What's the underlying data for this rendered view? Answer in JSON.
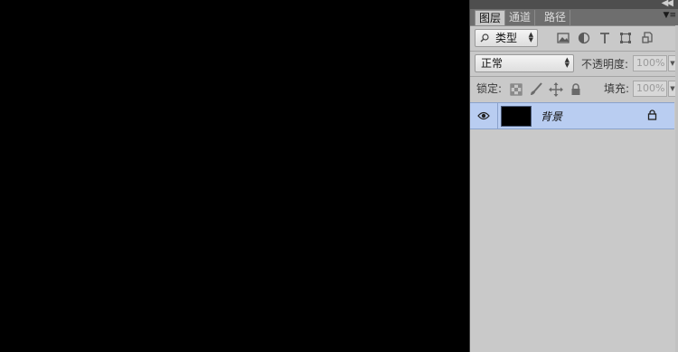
{
  "tabs": [
    {
      "label": "图层",
      "active": true
    },
    {
      "label": "通道",
      "active": false
    },
    {
      "label": "路径",
      "active": false
    }
  ],
  "filter": {
    "icon": "search-icon",
    "value": "类型"
  },
  "filter_icons": [
    "image-filter-icon",
    "adjustment-filter-icon",
    "text-filter-icon",
    "shape-filter-icon",
    "smart-object-filter-icon"
  ],
  "blend": {
    "value": "正常",
    "opacity_label": "不透明度:",
    "opacity_value": "100%"
  },
  "lock": {
    "label": "锁定:",
    "fill_label": "填充:",
    "fill_value": "100%"
  },
  "layers": [
    {
      "name": "背景",
      "visible": true,
      "locked": true,
      "thumb_color": "#000000"
    }
  ],
  "colors": {
    "canvas": "#000000",
    "panel_bg": "#c9c9c9",
    "selected_layer": "#b9cdf1"
  }
}
